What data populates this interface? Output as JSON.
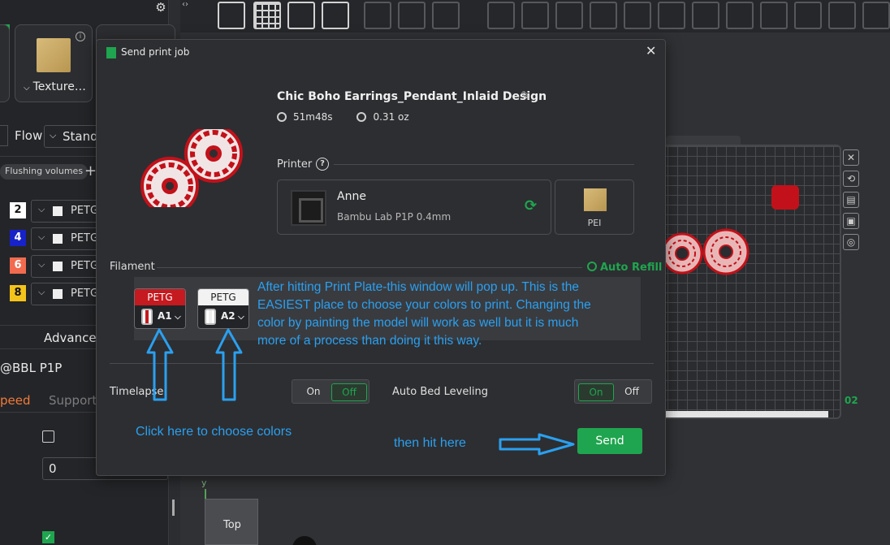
{
  "sidebar": {
    "texture_label": "Texture…",
    "flow_label": "Flow",
    "stand_select": "Stand",
    "flushing_label": "Flushing volumes",
    "plus": "+",
    "filaments": [
      {
        "num": "2",
        "num_color": "#ffffff",
        "num_text_color": "#111111",
        "label": "PETG"
      },
      {
        "num": "4",
        "num_color": "#1722c8",
        "num_text_color": "#ffffff",
        "label": "PETG"
      },
      {
        "num": "6",
        "num_color": "#f26b4e",
        "num_text_color": "#ffffff",
        "label": "PETG"
      },
      {
        "num": "8",
        "num_color": "#f4c31b",
        "num_text_color": "#111111",
        "label": "PETG"
      }
    ],
    "advanced_label": "Advanced",
    "printer_preset": "@BBL P1P",
    "tab_speed": "peed",
    "tab_support": "Support",
    "input_value": "0"
  },
  "viewport": {
    "plate_number": "02",
    "axis_label": "y",
    "view_cube_label": "Top"
  },
  "modal": {
    "title": "Send print job",
    "close": "✕",
    "job_name": "Chic Boho Earrings_Pendant_Inlaid Design",
    "print_time": "51m48s",
    "weight": "0.31 oz",
    "printer_section": "Printer",
    "help": "?",
    "printer_name": "Anne",
    "printer_model": "Bambu Lab P1P  0.4mm",
    "plate_type": "PEI",
    "filament_section": "Filament",
    "auto_refill": "Auto Refill",
    "filament_chips": [
      {
        "type": "PETG",
        "slot": "A1",
        "head_bg": "#c51a1f",
        "head_fg": "#ffffff"
      },
      {
        "type": "PETG",
        "slot": "A2",
        "head_bg": "#f2f2f2",
        "head_fg": "#222222"
      }
    ],
    "timelapse_label": "Timelapse",
    "timelapse_on": "On",
    "timelapse_off": "Off",
    "abl_label": "Auto Bed Leveling",
    "abl_on": "On",
    "abl_off": "Off",
    "send_label": "Send"
  },
  "annotations": {
    "main_text": "After hitting Print Plate-this window will pop up. This is the EASIEST place to choose your colors to print. Changing the color by painting the model will work as well but it is much more of a process than doing it this way.",
    "click_text": "Click here to choose colors",
    "hit_text": "then hit here",
    "color": "#2aa0f0"
  },
  "colors": {
    "accent_green": "#1fa54f",
    "model_red": "#c2111a"
  }
}
